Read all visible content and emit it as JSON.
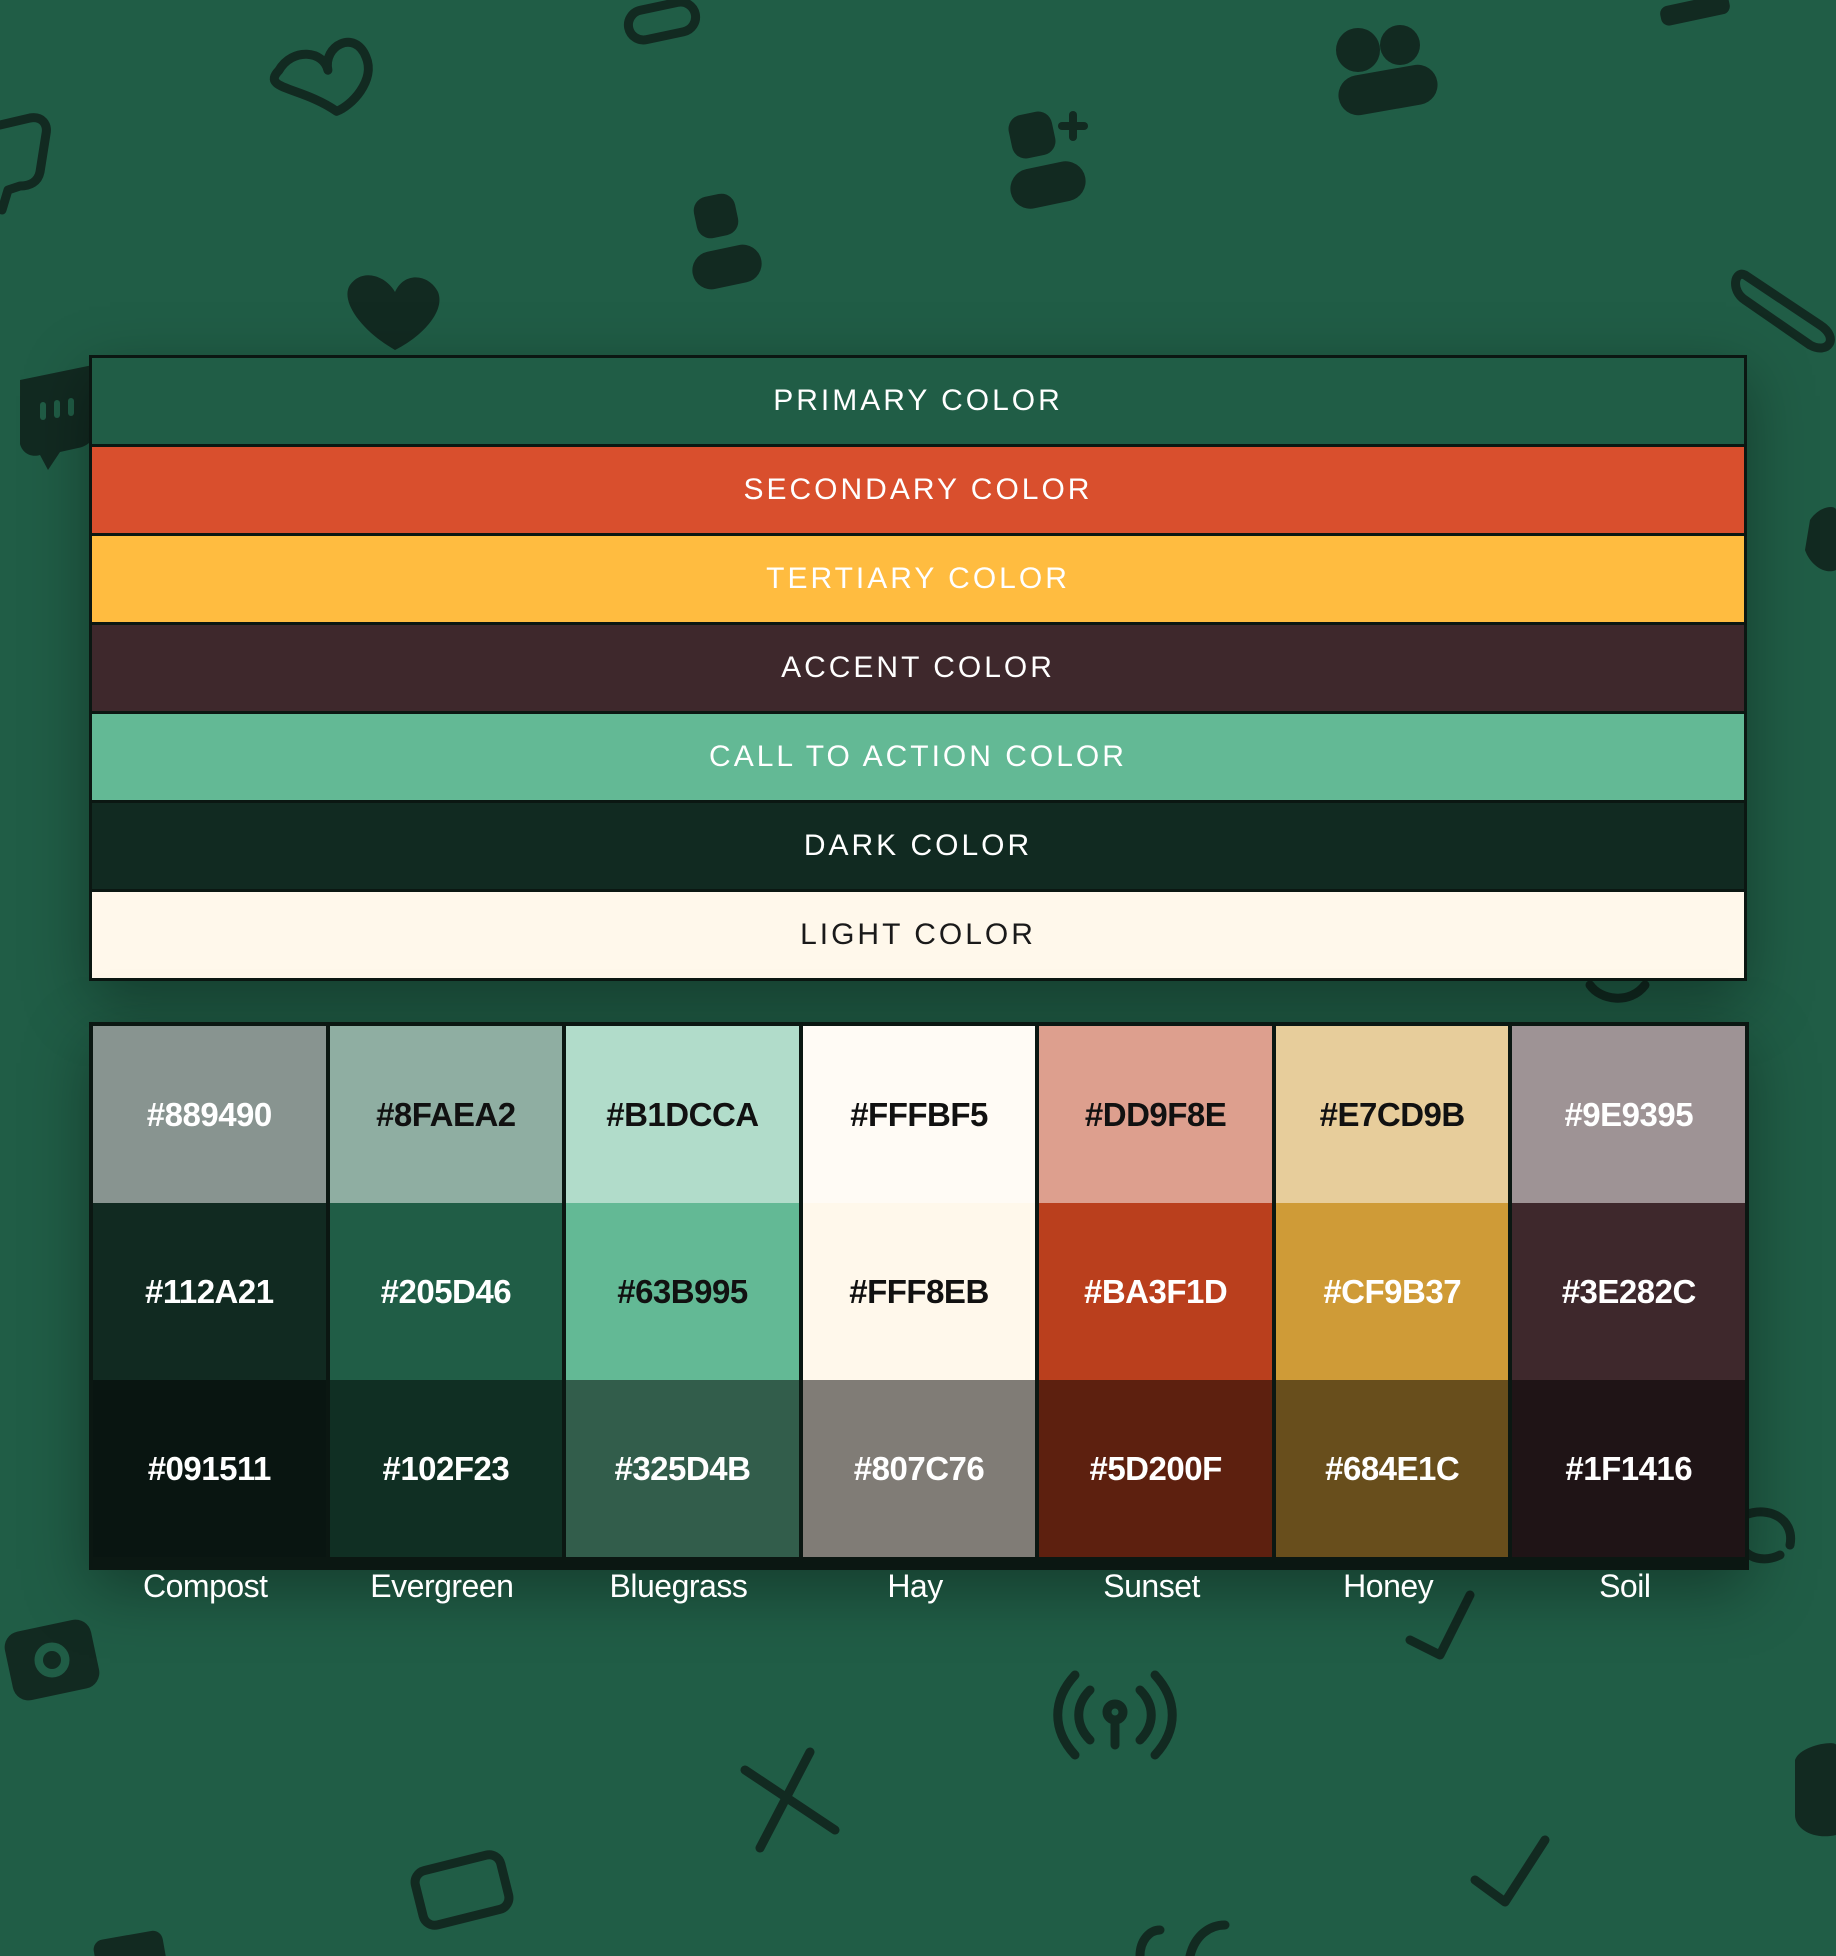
{
  "colors": {
    "background": "#205D46",
    "background_icon": "#122A21"
  },
  "background_icons": [
    "heart-outline-icon",
    "heart-icon",
    "chat-bubble-icon",
    "user-icon",
    "add-user-icon",
    "group-icon",
    "paperclip-icon",
    "camera-icon",
    "broadcast-icon",
    "close-icon",
    "checkmark-icon",
    "credit-card-icon",
    "sync-icon",
    "pill-icon"
  ],
  "roles": [
    {
      "label": "PRIMARY COLOR",
      "bg": "#205D46",
      "fg": "#ffffff"
    },
    {
      "label": "SECONDARY COLOR",
      "bg": "#D94F2D",
      "fg": "#ffffff"
    },
    {
      "label": "TERTIARY COLOR",
      "bg": "#FFBC40",
      "fg": "#ffffff"
    },
    {
      "label": "ACCENT COLOR",
      "bg": "#3E282C",
      "fg": "#ffffff"
    },
    {
      "label": "CALL TO ACTION COLOR",
      "bg": "#63B995",
      "fg": "#ffffff"
    },
    {
      "label": "DARK COLOR",
      "bg": "#112A21",
      "fg": "#ffffff"
    },
    {
      "label": "LIGHT COLOR",
      "bg": "#FFF8EB",
      "fg": "#1a1a1a"
    }
  ],
  "families": [
    {
      "name": "Compost",
      "swatches": [
        {
          "hex": "#889490",
          "fg": "#ffffff"
        },
        {
          "hex": "#112A21",
          "fg": "#ffffff"
        },
        {
          "hex": "#091511",
          "fg": "#ffffff"
        }
      ]
    },
    {
      "name": "Evergreen",
      "swatches": [
        {
          "hex": "#8FAEA2",
          "fg": "#111111"
        },
        {
          "hex": "#205D46",
          "fg": "#ffffff"
        },
        {
          "hex": "#102F23",
          "fg": "#ffffff"
        }
      ]
    },
    {
      "name": "Bluegrass",
      "swatches": [
        {
          "hex": "#B1DCCA",
          "fg": "#111111"
        },
        {
          "hex": "#63B995",
          "fg": "#111111"
        },
        {
          "hex": "#325D4B",
          "fg": "#ffffff"
        }
      ]
    },
    {
      "name": "Hay",
      "swatches": [
        {
          "hex": "#FFFBF5",
          "fg": "#111111"
        },
        {
          "hex": "#FFF8EB",
          "fg": "#111111"
        },
        {
          "hex": "#807C76",
          "fg": "#ffffff"
        }
      ]
    },
    {
      "name": "Sunset",
      "swatches": [
        {
          "hex": "#DD9F8E",
          "fg": "#111111"
        },
        {
          "hex": "#BA3F1D",
          "fg": "#ffffff"
        },
        {
          "hex": "#5D200F",
          "fg": "#ffffff"
        }
      ]
    },
    {
      "name": "Honey",
      "swatches": [
        {
          "hex": "#E7CD9B",
          "fg": "#111111"
        },
        {
          "hex": "#CF9B37",
          "fg": "#ffffff"
        },
        {
          "hex": "#684E1C",
          "fg": "#ffffff"
        }
      ]
    },
    {
      "name": "Soil",
      "swatches": [
        {
          "hex": "#9E9395",
          "fg": "#ffffff"
        },
        {
          "hex": "#3E282C",
          "fg": "#ffffff"
        },
        {
          "hex": "#1F1416",
          "fg": "#ffffff"
        }
      ]
    }
  ]
}
